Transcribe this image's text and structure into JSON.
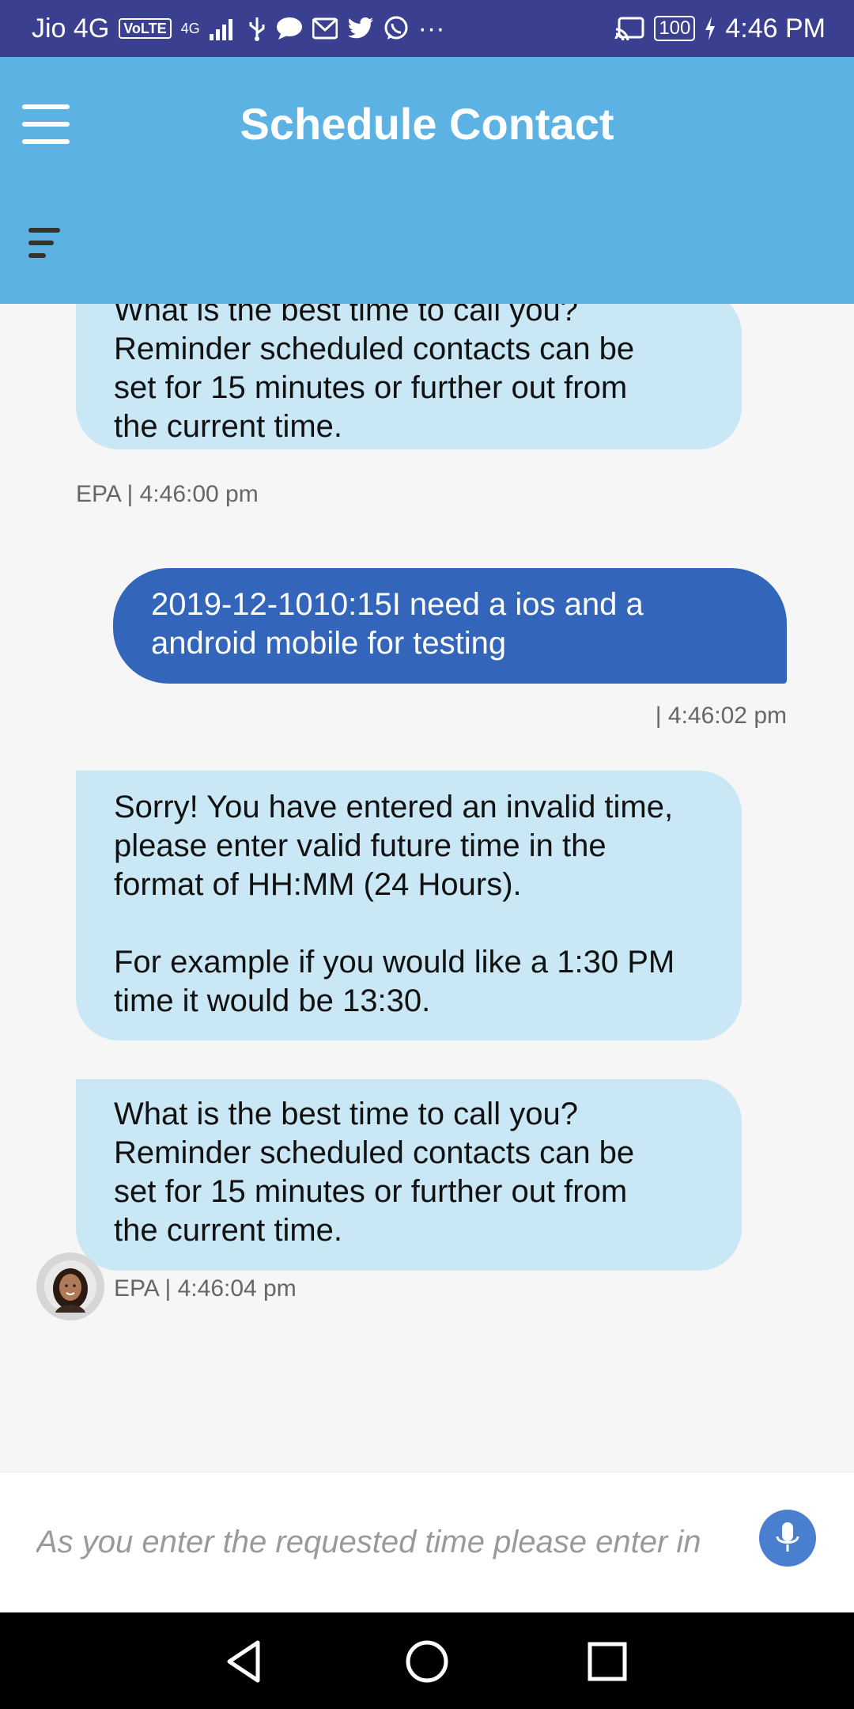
{
  "status_bar": {
    "carrier": "Jio 4G",
    "volte": "VoLTE",
    "network": "4G",
    "more": "···",
    "battery": "100",
    "time": "4:46 PM"
  },
  "app_bar": {
    "title": "Schedule Contact",
    "menu_icon": "hamburger-menu-icon",
    "sort_icon": "sort-lines-icon",
    "color": "#5cb2e3"
  },
  "messages": [
    {
      "sender": "bot",
      "lines": [
        "What is the best time to call you?",
        "Reminder scheduled contacts can be",
        "set for 15 minutes or further out from",
        "the current time."
      ],
      "meta": "EPA | 4:46:00 pm"
    },
    {
      "sender": "user",
      "lines": [
        "2019-12-1010:15I need a ios and a",
        "android mobile for testing"
      ],
      "meta": "| 4:46:02 pm"
    },
    {
      "sender": "bot",
      "lines": [
        "Sorry! You have entered an invalid time,",
        "please enter valid future time in the",
        "format of HH:MM (24 Hours).",
        "",
        "For example if you would like a 1:30 PM",
        "time it would be 13:30."
      ],
      "meta": ""
    },
    {
      "sender": "bot",
      "lines": [
        "What is the best time to call you?",
        "Reminder scheduled contacts can be",
        "set for 15 minutes or further out from",
        "the current time."
      ],
      "meta": "EPA | 4:46:04 pm"
    }
  ],
  "input": {
    "placeholder": "As you enter the requested time please enter in",
    "mic_icon": "microphone-icon"
  },
  "colors": {
    "bot_bubble": "#c9e7f5",
    "user_bubble": "#3366bb",
    "status_bar": "#3a3f8f",
    "mic_button": "#4a7fd0"
  }
}
